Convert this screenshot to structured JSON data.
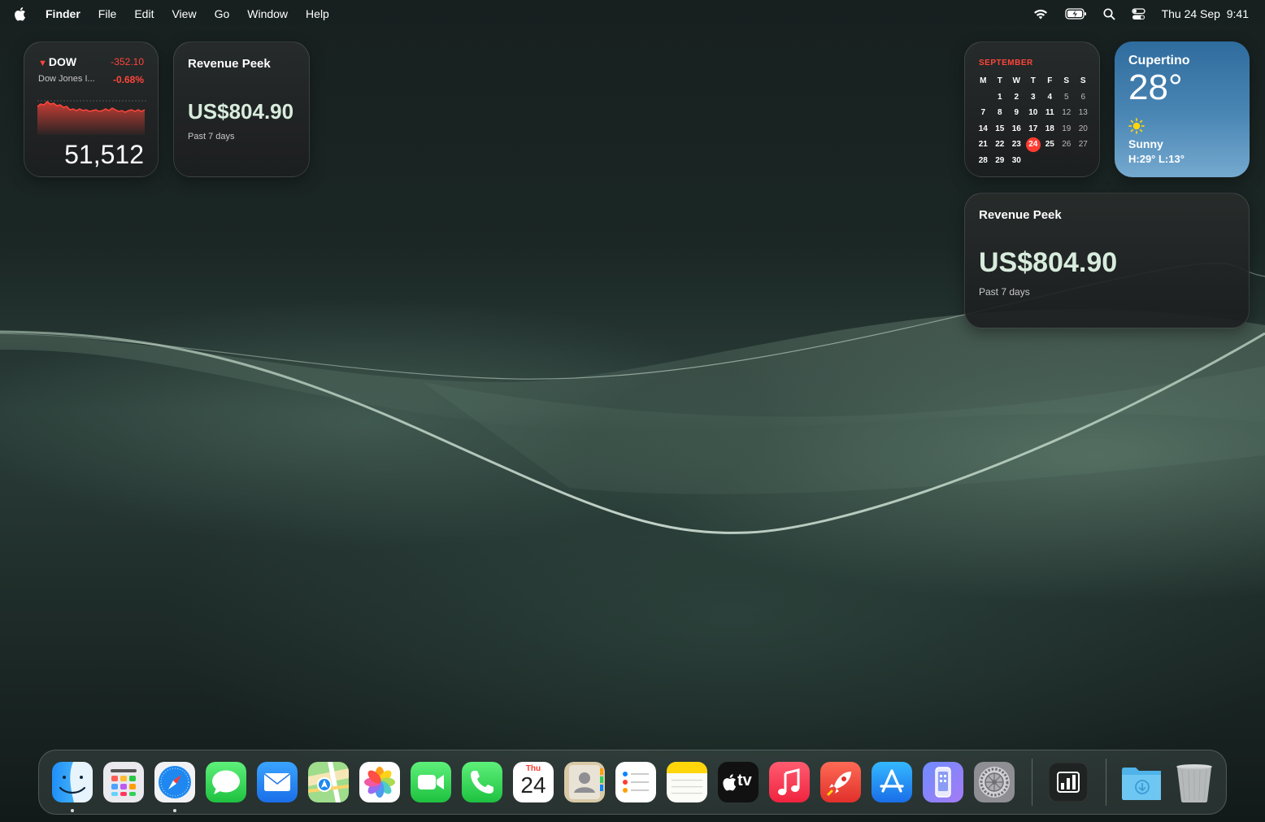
{
  "menubar": {
    "app_name": "Finder",
    "menus": [
      "File",
      "Edit",
      "View",
      "Go",
      "Window",
      "Help"
    ],
    "status_icons": [
      "wifi-icon",
      "battery-icon",
      "search-icon",
      "control-center-icon"
    ],
    "clock": "Thu 24 Sep  9:41"
  },
  "stock_widget": {
    "symbol": "DOW",
    "change": "-352.10",
    "name": "Dow Jones I...",
    "percent": "-0.68%",
    "price": "51,512",
    "color": "#ff453a"
  },
  "revenue_widget_small": {
    "title": "Revenue Peek",
    "value": "US$804.90",
    "subtitle": "Past 7 days"
  },
  "revenue_widget_medium": {
    "title": "Revenue Peek",
    "value": "US$804.90",
    "subtitle": "Past 7 days"
  },
  "calendar_widget": {
    "month": "SEPTEMBER",
    "weekday_headers": [
      "M",
      "T",
      "W",
      "T",
      "F",
      "S",
      "S"
    ],
    "first_weekday_offset": 1,
    "days_in_month": 30,
    "today": 24,
    "today_color": "#ff3b30"
  },
  "weather_widget": {
    "city": "Cupertino",
    "temperature": "28°",
    "condition": "Sunny",
    "high_low": "H:29° L:13°"
  },
  "dock": {
    "apps": [
      {
        "name": "finder-icon",
        "running": true
      },
      {
        "name": "launchpad-icon",
        "running": false
      },
      {
        "name": "safari-icon",
        "running": true
      },
      {
        "name": "messages-icon",
        "running": false
      },
      {
        "name": "mail-icon",
        "running": false
      },
      {
        "name": "maps-icon",
        "running": false
      },
      {
        "name": "photos-icon",
        "running": false
      },
      {
        "name": "facetime-icon",
        "running": false
      },
      {
        "name": "phone-icon",
        "running": false
      },
      {
        "name": "calendar-icon",
        "running": false,
        "weekday": "Thu",
        "day": "24"
      },
      {
        "name": "contacts-icon",
        "running": false
      },
      {
        "name": "reminders-icon",
        "running": false
      },
      {
        "name": "notes-icon",
        "running": false
      },
      {
        "name": "apple-tv-icon",
        "running": false,
        "label": "tv"
      },
      {
        "name": "music-icon",
        "running": false
      },
      {
        "name": "rocket-icon",
        "running": false
      },
      {
        "name": "app-store-icon",
        "running": false
      },
      {
        "name": "iphone-mirroring-icon",
        "running": false
      },
      {
        "name": "system-settings-icon",
        "running": false
      },
      {
        "name": "revenue-app-icon",
        "running": false
      },
      {
        "name": "downloads-folder-icon",
        "running": false
      },
      {
        "name": "trash-icon",
        "running": false
      }
    ]
  }
}
